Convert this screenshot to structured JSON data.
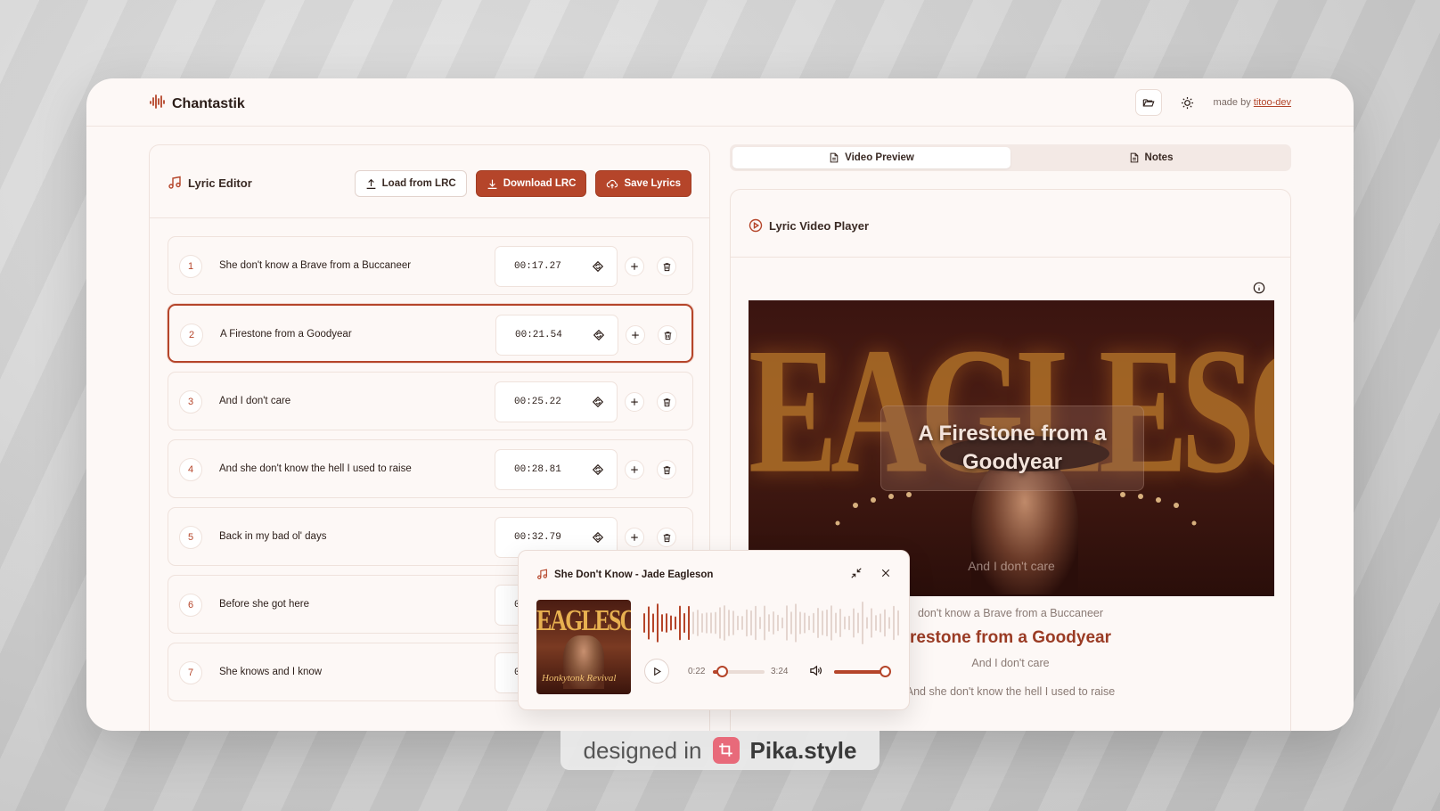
{
  "app": {
    "name": "Chantastik",
    "made_by_prefix": "made by",
    "made_by_link": "titoo-dev"
  },
  "colors": {
    "accent": "#b5452a",
    "background": "#fdf8f6",
    "border": "#efe2dc"
  },
  "editor": {
    "title": "Lyric Editor",
    "load_label": "Load from LRC",
    "download_label": "Download LRC",
    "save_label": "Save Lyrics",
    "active_index": 1,
    "lines": [
      {
        "num": "1",
        "text": "She don't know a Brave from a Buccaneer",
        "time": "00:17.27"
      },
      {
        "num": "2",
        "text": "A Firestone from a Goodyear",
        "time": "00:21.54"
      },
      {
        "num": "3",
        "text": "And I don't care",
        "time": "00:25.22"
      },
      {
        "num": "4",
        "text": "And she don't know the hell I used to raise",
        "time": "00:28.81"
      },
      {
        "num": "5",
        "text": "Back in my bad ol' days",
        "time": "00:32.79"
      },
      {
        "num": "6",
        "text": "Before she got here",
        "time": "0"
      },
      {
        "num": "7",
        "text": "She knows and I know",
        "time": "0"
      }
    ]
  },
  "tabs": {
    "video_preview": "Video Preview",
    "notes": "Notes"
  },
  "player": {
    "title": "Lyric Video Player",
    "video_bg_text": "EAGLESON",
    "current_overlay": "A Firestone from a Goodyear",
    "next_line": "And I don't care",
    "lyric_prev": "don't know a Brave from a Buccaneer",
    "lyric_current": "restone from a Goodyear",
    "lyric_next": "And I don't care",
    "lyric_next2": "And she don't know the hell I used to raise"
  },
  "mini_player": {
    "track": "She Don't Know - Jade Eagleson",
    "cover_title": "EAGLESON",
    "cover_sub": "Honkytonk Revival",
    "current_time": "0:22",
    "duration": "3:24",
    "progress": 0.18,
    "volume": 0.95
  },
  "watermark": {
    "prefix": "designed in",
    "brand": "Pika.style"
  }
}
